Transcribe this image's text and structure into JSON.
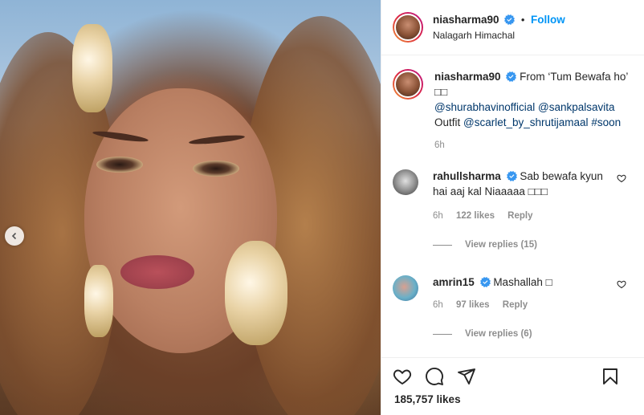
{
  "header": {
    "username": "niasharma90",
    "dot": "•",
    "follow_label": "Follow",
    "location": "Nalagarh Himachal"
  },
  "caption": {
    "username": "niasharma90",
    "text": "From ‘Tum Bewafa ho’",
    "emoji": "□□",
    "mention1": "@shurabhavinofficial",
    "mention2": "@sankpalsavita",
    "outfit_prefix": "Outfit",
    "mention3": "@scarlet_by_shrutijamaal",
    "hashtag": "#soon",
    "time": "6h"
  },
  "comments": [
    {
      "username": "rahullsharma",
      "text": "Sab bewafa kyun hai aaj kal Niaaaaa □□□",
      "time": "6h",
      "likes": "122 likes",
      "reply_label": "Reply",
      "view_replies": "View replies (15)"
    },
    {
      "username": "amrin15",
      "text": "Mashallah □",
      "time": "6h",
      "likes": "97 likes",
      "reply_label": "Reply",
      "view_replies": "View replies (6)"
    }
  ],
  "footer": {
    "likes_count": "185,757 likes"
  },
  "icons": {
    "verified": "verified-badge-icon",
    "like": "heart-icon",
    "comment": "comment-bubble-icon",
    "share": "paper-plane-icon",
    "save": "bookmark-icon",
    "carousel_prev": "chevron-left-icon"
  },
  "colors": {
    "link": "#00376b",
    "follow": "#0095f6",
    "verified": "#3897f0",
    "muted": "#8e8e8e"
  }
}
